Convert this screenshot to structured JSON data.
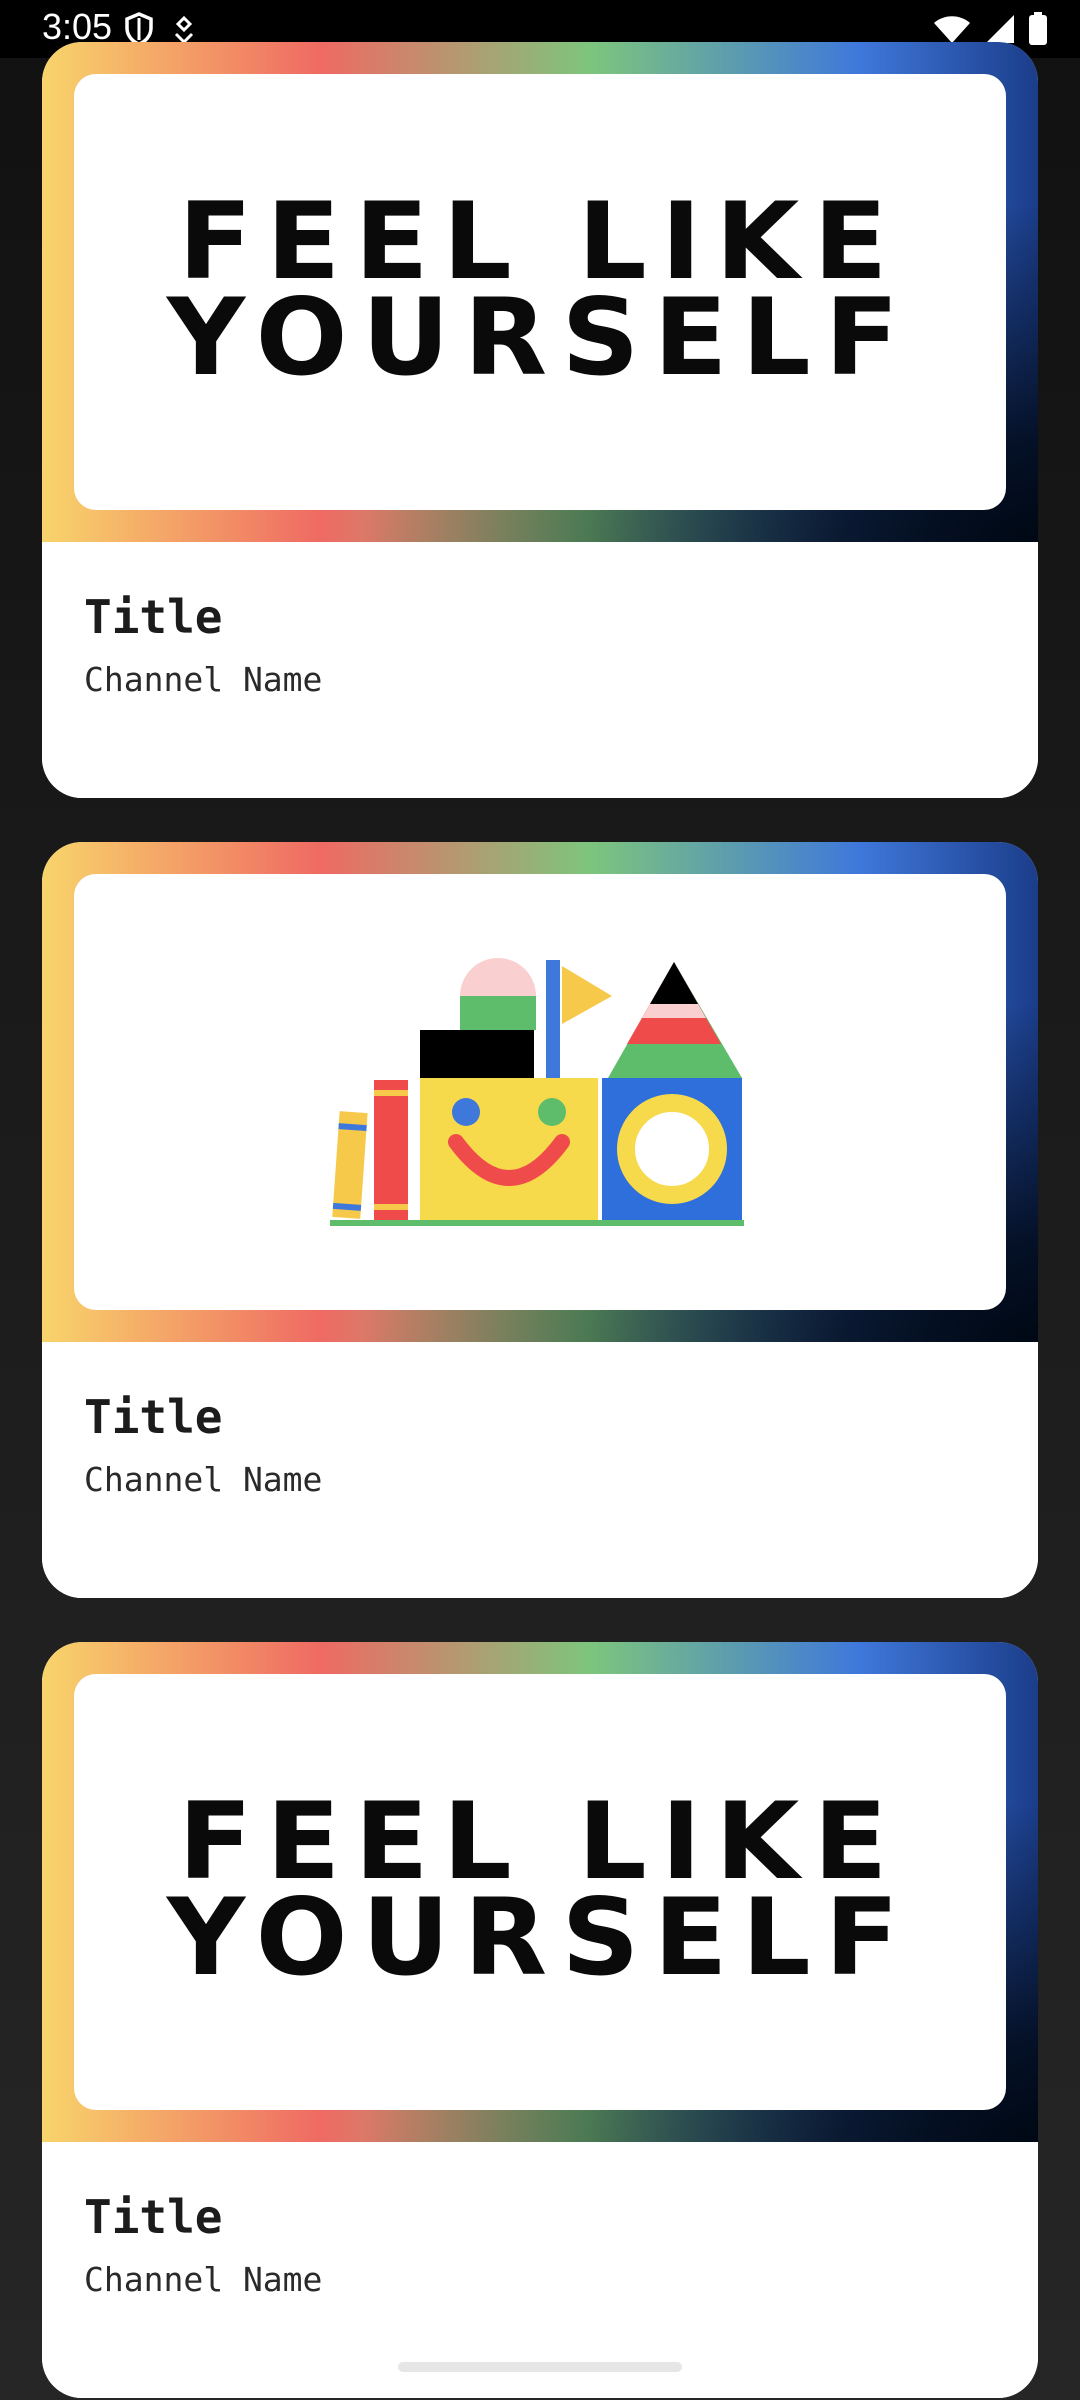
{
  "status_bar": {
    "time": "3:05",
    "left_icons": [
      "shield-icon",
      "download-notification-icon"
    ],
    "right_icons": [
      "wifi-icon",
      "cell-signal-icon",
      "battery-icon"
    ]
  },
  "cards": [
    {
      "thumbnail": "feel-like-yourself",
      "thumbnail_text": "FEEL LIKE YOURSELF",
      "title": "Title",
      "channel": "Channel Name"
    },
    {
      "thumbnail": "toy-blocks",
      "title": "Title",
      "channel": "Channel Name"
    },
    {
      "thumbnail": "feel-like-yourself",
      "thumbnail_text": "FEEL LIKE YOURSELF",
      "title": "Title",
      "channel": "Channel Name"
    }
  ],
  "colors": {
    "gradient": [
      "#f8d46b",
      "#ef6a63",
      "#7dc57d",
      "#3f78db",
      "#000814"
    ],
    "background": "#111111"
  }
}
